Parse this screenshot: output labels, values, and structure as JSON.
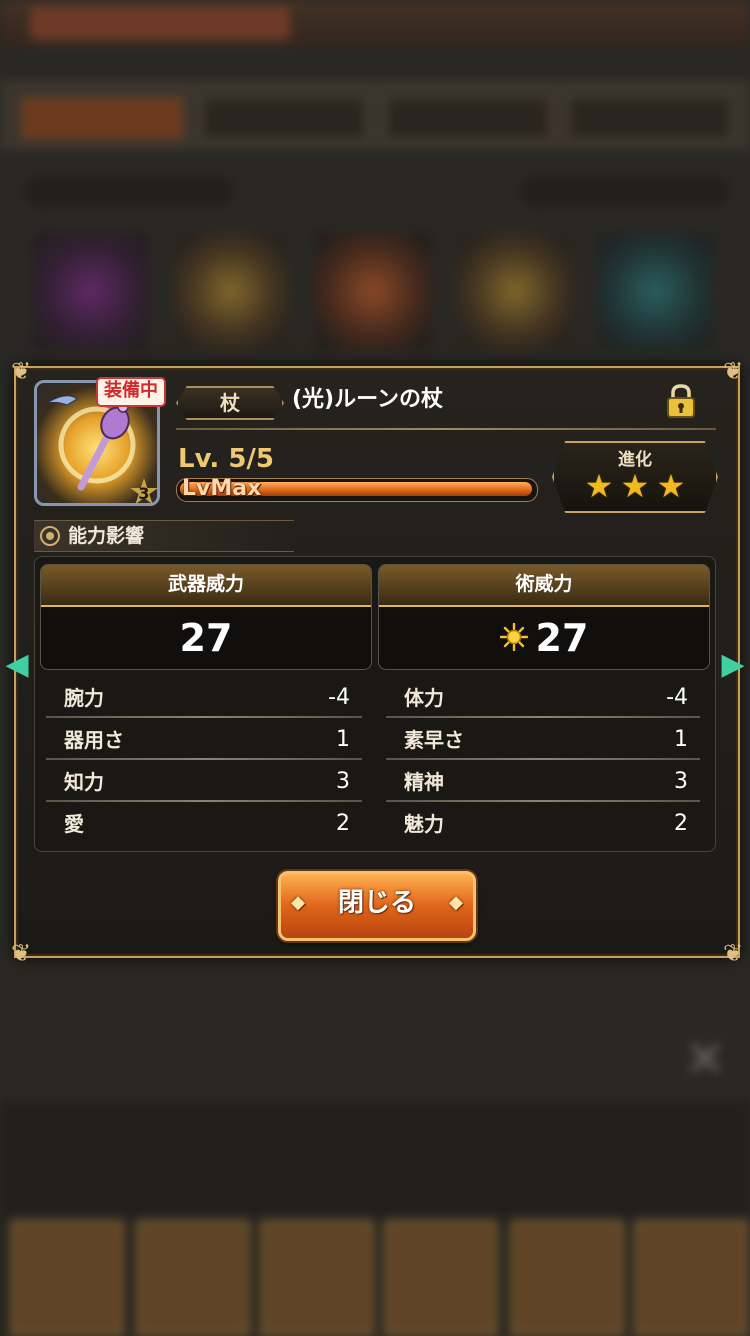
{
  "dialog": {
    "equip_badge": "装備中",
    "rarity": "3",
    "weapon_type": "杖",
    "weapon_name": "(光)ルーンの杖",
    "level_text": "Lv. 5/5",
    "level_bar_label": "LvMax",
    "level_progress": 1.0,
    "evolution": {
      "label": "進化",
      "stars": 3,
      "max_stars": 3
    },
    "ability_header": "能力影響",
    "weapon_power": {
      "label": "武器威力",
      "value": "27"
    },
    "art_power": {
      "label": "術威力",
      "value": "27",
      "element_icon": "light-sun-icon"
    },
    "stats_left": [
      {
        "name": "腕力",
        "value": "-4"
      },
      {
        "name": "器用さ",
        "value": "1"
      },
      {
        "name": "知力",
        "value": "3"
      },
      {
        "name": "愛",
        "value": "2"
      }
    ],
    "stats_right": [
      {
        "name": "体力",
        "value": "-4"
      },
      {
        "name": "素早さ",
        "value": "1"
      },
      {
        "name": "精神",
        "value": "3"
      },
      {
        "name": "魅力",
        "value": "2"
      }
    ],
    "close_label": "閉じる"
  },
  "colors": {
    "accent_gold": "#c8a060",
    "button_orange": "#e0661a",
    "badge_red": "#d02a2a",
    "star_gold": "#f2b820",
    "nav_arrow": "#3ed0a0"
  }
}
